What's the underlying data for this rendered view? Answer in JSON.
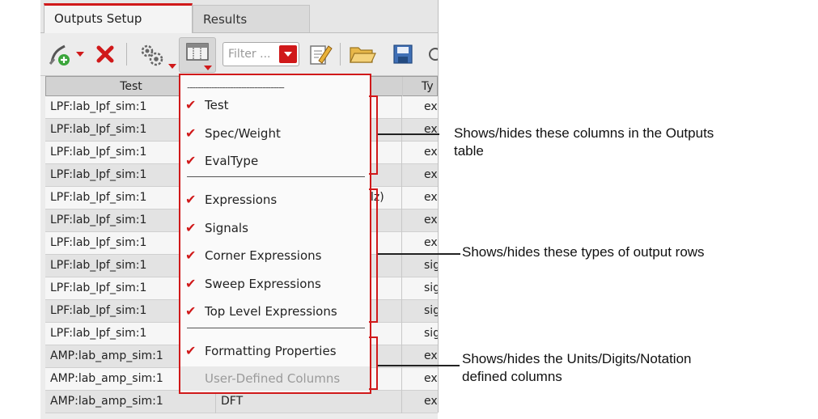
{
  "tabs": [
    {
      "label": "Outputs Setup",
      "active": true
    },
    {
      "label": "Results",
      "active": false
    }
  ],
  "toolbar": {
    "filter_placeholder": "Filter ..."
  },
  "table": {
    "headers": [
      "Test",
      "Ty"
    ],
    "rows": [
      {
        "test": "LPF:lab_lpf_sim:1",
        "name": "",
        "frag": "",
        "type": "ex"
      },
      {
        "test": "LPF:lab_lpf_sim:1",
        "name": "",
        "frag": "",
        "type": "ex"
      },
      {
        "test": "LPF:lab_lpf_sim:1",
        "name": "",
        "frag": "",
        "type": "ex"
      },
      {
        "test": "LPF:lab_lpf_sim:1",
        "name": "",
        "frag": "",
        "type": "ex"
      },
      {
        "test": "LPF:lab_lpf_sim:1",
        "name": "",
        "frag": "lz)",
        "type": "ex"
      },
      {
        "test": "LPF:lab_lpf_sim:1",
        "name": "",
        "frag": "",
        "type": "ex"
      },
      {
        "test": "LPF:lab_lpf_sim:1",
        "name": "",
        "frag": "",
        "type": "ex"
      },
      {
        "test": "LPF:lab_lpf_sim:1",
        "name": "",
        "frag": "",
        "type": "sig"
      },
      {
        "test": "LPF:lab_lpf_sim:1",
        "name": "",
        "frag": "",
        "type": "sig"
      },
      {
        "test": "LPF:lab_lpf_sim:1",
        "name": "",
        "frag": "",
        "type": "sig"
      },
      {
        "test": "LPF:lab_lpf_sim:1",
        "name": "",
        "frag": "",
        "type": "sig"
      },
      {
        "test": "AMP:lab_amp_sim:1",
        "name": "",
        "frag": "",
        "type": "ex"
      },
      {
        "test": "AMP:lab_amp_sim:1",
        "name": "",
        "frag": "",
        "type": "ex"
      },
      {
        "test": "AMP:lab_amp_sim:1",
        "name": "DFT",
        "frag": "",
        "type": "ex"
      }
    ]
  },
  "menu": {
    "dashes": "------------------------------------",
    "groups": [
      {
        "items": [
          {
            "label": "Test",
            "checked": true
          },
          {
            "label": "Spec/Weight",
            "checked": true
          },
          {
            "label": "EvalType",
            "checked": true
          }
        ]
      },
      {
        "items": [
          {
            "label": "Expressions",
            "checked": true
          },
          {
            "label": "Signals",
            "checked": true
          },
          {
            "label": "Corner Expressions",
            "checked": true
          },
          {
            "label": "Sweep Expressions",
            "checked": true
          },
          {
            "label": "Top Level Expressions",
            "checked": true
          }
        ]
      },
      {
        "items": [
          {
            "label": "Formatting Properties",
            "checked": true
          },
          {
            "label": "User-Defined Columns",
            "checked": false,
            "disabled": true
          }
        ]
      }
    ],
    "check_glyph": "✔"
  },
  "annotations": {
    "columns": [
      "Shows/hides these columns in the Outputs",
      "table"
    ],
    "rows": [
      "Shows/hides these types of output rows"
    ],
    "formatting": [
      "Shows/hides the Units/Digits/Notation",
      "defined columns"
    ]
  },
  "colors": {
    "accent": "#d0191a",
    "tab_bar": "#e6e6e6",
    "row_alt": "#e3e3e3"
  },
  "icons": [
    "add-output-icon",
    "delete-icon",
    "settings-gears-icon",
    "column-selector-icon",
    "filter-dropdown-icon",
    "edit-icon",
    "open-folder-icon",
    "save-icon",
    "overflow-icon"
  ]
}
